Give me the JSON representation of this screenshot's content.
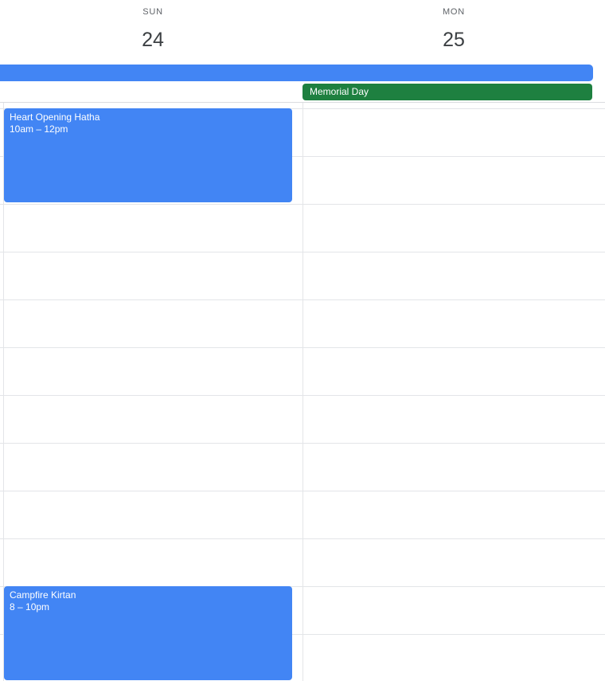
{
  "days": [
    {
      "dow": "SUN",
      "date": "24"
    },
    {
      "dow": "MON",
      "date": "25"
    }
  ],
  "all_day": {
    "memorial_day": {
      "label": "Memorial Day",
      "color": "#1e8040"
    },
    "multi_day_bar_color": "#4285f4"
  },
  "events": [
    {
      "title": "Heart Opening Hatha",
      "time": "10am – 12pm",
      "color": "#4285f4"
    },
    {
      "title": "Campfire Kirtan",
      "time": "8 – 10pm",
      "color": "#4285f4"
    }
  ]
}
